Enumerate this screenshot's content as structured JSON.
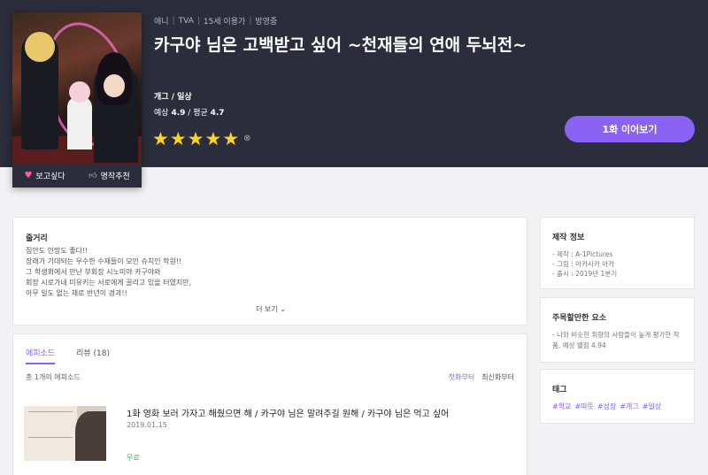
{
  "hero": {
    "meta": [
      "애니",
      "TVA",
      "15세 이용가",
      "방영중"
    ],
    "title": "카구야 님은 고백받고 싶어 ~천재들의 연애 두뇌전~",
    "genre": "개그 / 일상",
    "score_label": "예상",
    "score_expected": "4.9",
    "score_avg_label": "평균",
    "score_avg": "4.7",
    "rating": 5,
    "play_button": "1화 이어보기",
    "wish_label": "보고싶다",
    "recommend_label": "명작추천",
    "colors": {
      "accent": "#8a63f5",
      "star": "#ffd21f",
      "bg": "#2b2c3c"
    }
  },
  "synopsis": {
    "title": "줄거리",
    "lines": [
      "집안도 인망도 좋다!!",
      "장래가 기대되는 우수한 수재들이 모인 슈치인 학원!!",
      "그 학생회에서 만난 부회장 시노미야 카구야와",
      "회장 시로가네 미유키는 서로에게 끌리고 있을 터였지만,",
      "아무 일도 없는 채로 반년이 경과!!"
    ],
    "more": "더 보기"
  },
  "episodes": {
    "tab_episode": "에피소드",
    "tab_review": "리뷰 (18)",
    "count_text": "총 1개의 에피소드",
    "sort_first": "첫화부터",
    "sort_new": "최신화부터",
    "items": [
      {
        "title": "1화 영화 보러 가자고 해줬으면 해 / 카구야 님은 말려주길 원해 / 카구야 님은 먹고 싶어",
        "date": "2019.01.15",
        "price": "무료"
      }
    ]
  },
  "production": {
    "title": "제작 정보",
    "items": [
      "- 제작 : A-1Pictures",
      "- 그림 : 아카사카 아카",
      "- 출시 : 2019년 1분기"
    ]
  },
  "notable": {
    "title": "주목할만한 요소",
    "text": "- 나와 비슷한 취향의 사람들이 높게 평가한 작품, 예상 별점 4.94"
  },
  "tags": {
    "title": "태그",
    "items": [
      "#학교",
      "#따뜻",
      "#성장",
      "#개그",
      "#일상"
    ]
  }
}
